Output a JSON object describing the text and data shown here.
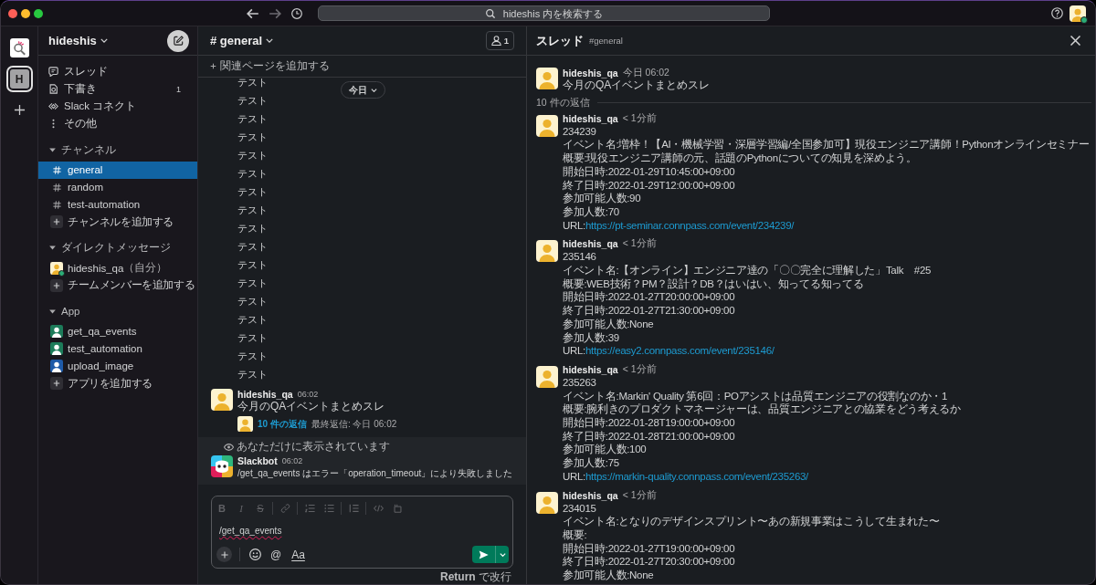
{
  "window": {
    "search": {
      "placeholder": "hideshis 内を検索する"
    },
    "user": {
      "online": true
    }
  },
  "rail": [
    {
      "kind": "logo",
      "selected": false
    },
    {
      "kind": "initial",
      "label": "H",
      "selected": true
    }
  ],
  "sidebar": {
    "workspace": "hideshis",
    "nav": [
      {
        "kind": "threads",
        "label": "スレッド"
      },
      {
        "kind": "drafts",
        "label": "下書き",
        "count": "1"
      },
      {
        "kind": "connect",
        "label": "Slack コネクト"
      },
      {
        "kind": "more",
        "label": "その他"
      }
    ],
    "sections": [
      {
        "kind": "channels",
        "title": "チャンネル",
        "expanded": true,
        "items": [
          {
            "label": "general",
            "selected": true
          },
          {
            "label": "random",
            "selected": false
          },
          {
            "label": "test-automation",
            "selected": false
          }
        ],
        "add_label": "チャンネルを追加する"
      },
      {
        "kind": "direct",
        "title": "ダイレクトメッセージ",
        "expanded": true,
        "items": [
          {
            "label": "hideshis_qa",
            "note": "（自分）",
            "online": true,
            "selected": false
          }
        ],
        "add_label": "チームメンバーを追加する"
      },
      {
        "kind": "apps",
        "title": "App",
        "expanded": true,
        "items": [
          {
            "label": "get_qa_events",
            "color": "#1d7c5a",
            "selected": false
          },
          {
            "label": "test_automation",
            "color": "#1d7c5a",
            "selected": false
          },
          {
            "label": "upload_image",
            "color": "#1e5aa8",
            "selected": false
          }
        ],
        "add_label": "アプリを追加する"
      }
    ]
  },
  "channel": {
    "title": "# general",
    "members": "1",
    "bookmark": "関連ページを追加する",
    "date": "今日",
    "messages": [
      {
        "kind": "compact",
        "text": "テスト"
      },
      {
        "kind": "compact",
        "text": "テスト"
      },
      {
        "kind": "compact",
        "text": "テスト"
      },
      {
        "kind": "compact",
        "text": "テスト"
      },
      {
        "kind": "compact",
        "text": "テスト"
      },
      {
        "kind": "compact",
        "text": "テスト"
      },
      {
        "kind": "compact",
        "text": "テスト"
      },
      {
        "kind": "compact",
        "text": "テスト"
      },
      {
        "kind": "compact",
        "text": "テスト"
      },
      {
        "kind": "compact",
        "text": "テスト"
      },
      {
        "kind": "compact",
        "text": "テスト"
      },
      {
        "kind": "compact",
        "text": "テスト"
      },
      {
        "kind": "compact",
        "text": "テスト"
      },
      {
        "kind": "compact",
        "text": "テスト"
      },
      {
        "kind": "compact",
        "text": "テスト"
      },
      {
        "kind": "compact",
        "text": "テスト"
      },
      {
        "kind": "compact",
        "text": "テスト"
      },
      {
        "kind": "message",
        "avatar": {
          "kind": "person"
        },
        "author": "hideshis_qa",
        "time": "06:02",
        "text": "今月のQAイベントまとめスレ",
        "thread": {
          "replies": "10 件の返信",
          "last_reply": "最終返信: 今日 06:02"
        }
      },
      {
        "kind": "ephemeral",
        "notice": "あなただけに表示されています",
        "avatar": {
          "kind": "bot"
        },
        "author": "Slackbot",
        "time": "06:02",
        "text": "/get_qa_events はエラー「operation_timeout」により失敗しました"
      }
    ],
    "composer": {
      "formatting_disabled": true,
      "format_groups": [
        [
          {
            "kind": "bold",
            "label": "B"
          },
          {
            "kind": "italic",
            "label": "I"
          },
          {
            "kind": "strike",
            "label": "S"
          }
        ],
        [
          {
            "kind": "link"
          }
        ],
        [
          {
            "kind": "ordered_list"
          },
          {
            "kind": "bulleted_list"
          }
        ],
        [
          {
            "kind": "quote"
          }
        ],
        [
          {
            "kind": "code"
          },
          {
            "kind": "code_block"
          }
        ]
      ],
      "value": "/get_qa_events",
      "spelling_error": true,
      "actions": [
        {
          "kind": "attach"
        },
        {
          "kind": "emoji"
        },
        {
          "kind": "mention",
          "label": "@"
        },
        {
          "kind": "format",
          "label": "Aa"
        }
      ],
      "hint": "**Return** で改行"
    }
  },
  "thread": {
    "title": "スレッド",
    "channel": "#general",
    "parent": {
      "avatar": {
        "kind": "person"
      },
      "author": "hideshis_qa",
      "time": "今日 06:02",
      "text": "今月のQAイベントまとめスレ"
    },
    "reply_count": "10 件の返信",
    "replies": [
      {
        "avatar": {
          "kind": "person"
        },
        "author": "hideshis_qa",
        "time": "< 1分前",
        "lines": [
          "234239",
          "イベント名:増枠！【AI・機械学習・深層学習編/全国参加可】現役エンジニア講師！Pythonオンラインセミナー",
          "概要:現役エンジニア講師の元、話題のPythonについての知見を深めよう。",
          "開始日時:2022-01-29T10:45:00+09:00",
          "終了日時:2022-01-29T12:00:00+09:00",
          "参加可能人数:90",
          "参加人数:70"
        ],
        "url": {
          "label": "URL:",
          "link": "https://pt-seminar.connpass.com/event/234239/"
        }
      },
      {
        "avatar": {
          "kind": "person"
        },
        "author": "hideshis_qa",
        "time": "< 1分前",
        "lines": [
          "235146",
          "イベント名:【オンライン】エンジニア達の「〇〇完全に理解した」Talk　#25",
          "概要:WEB技術？PM？設計？DB？はいはい、知ってる知ってる",
          "開始日時:2022-01-27T20:00:00+09:00",
          "終了日時:2022-01-27T21:30:00+09:00",
          "参加可能人数:None",
          "参加人数:39"
        ],
        "url": {
          "label": "URL:",
          "link": "https://easy2.connpass.com/event/235146/"
        }
      },
      {
        "avatar": {
          "kind": "person"
        },
        "author": "hideshis_qa",
        "time": "< 1分前",
        "lines": [
          "235263",
          "イベント名:Markin' Quality 第6回：POアシストは品質エンジニアの役割なのか・1",
          "概要:腕利きのプロダクトマネージャーは、品質エンジニアとの協業をどう考えるか",
          "開始日時:2022-01-28T19:00:00+09:00",
          "終了日時:2022-01-28T21:00:00+09:00",
          "参加可能人数:100",
          "参加人数:75"
        ],
        "url": {
          "label": "URL:",
          "link": "https://markin-quality.connpass.com/event/235263/"
        }
      },
      {
        "avatar": {
          "kind": "person"
        },
        "author": "hideshis_qa",
        "time": "< 1分前",
        "lines": [
          "234015",
          "イベント名:となりのデザインスプリント〜あの新規事業はこうして生まれた〜",
          "概要:",
          "開始日時:2022-01-27T19:00:00+09:00",
          "終了日時:2022-01-27T20:30:00+09:00",
          "参加可能人数:None"
        ]
      }
    ]
  }
}
